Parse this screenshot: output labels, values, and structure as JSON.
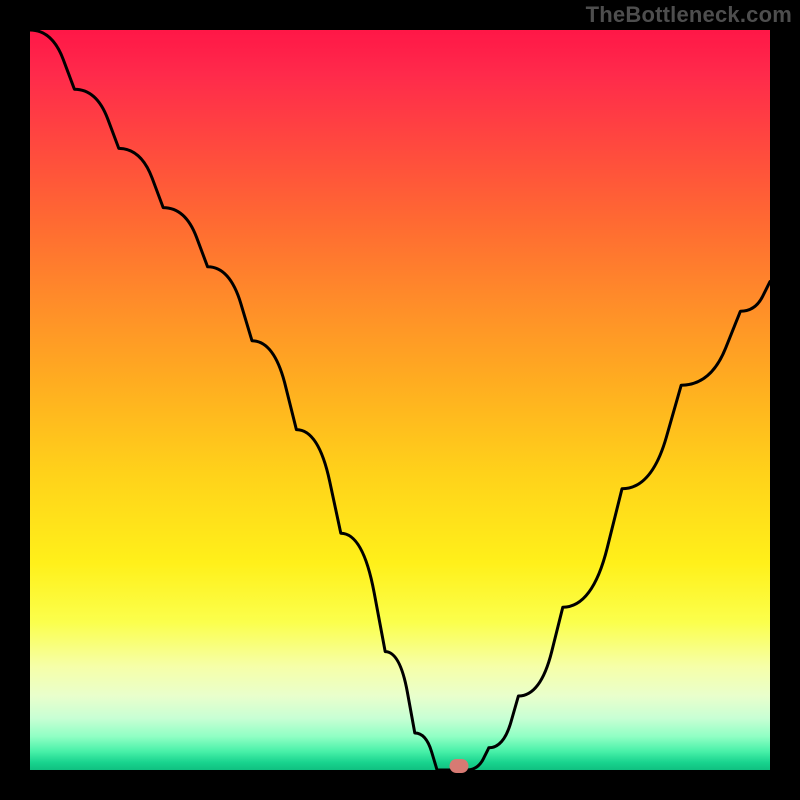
{
  "watermark": "TheBottleneck.com",
  "chart_data": {
    "type": "line",
    "title": "",
    "xlabel": "",
    "ylabel": "",
    "xlim": [
      0,
      100
    ],
    "ylim": [
      0,
      100
    ],
    "grid": false,
    "curve_color": "#000000",
    "background_gradient": {
      "direction": "vertical",
      "stops": [
        {
          "pos": 0,
          "color": "#ff1747"
        },
        {
          "pos": 50,
          "color": "#ffb020"
        },
        {
          "pos": 80,
          "color": "#fff04a"
        },
        {
          "pos": 100,
          "color": "#10c080"
        }
      ]
    },
    "series": [
      {
        "name": "bottleneck-curve",
        "x": [
          0,
          6,
          12,
          18,
          24,
          30,
          36,
          42,
          48,
          52,
          55,
          57,
          59,
          62,
          66,
          72,
          80,
          88,
          96,
          100
        ],
        "y": [
          100,
          92,
          84,
          76,
          68,
          58,
          46,
          32,
          16,
          5,
          0,
          0,
          0,
          3,
          10,
          22,
          38,
          52,
          62,
          66
        ]
      }
    ],
    "marker": {
      "x": 58,
      "y": 0.5,
      "color": "#d77a73"
    }
  }
}
